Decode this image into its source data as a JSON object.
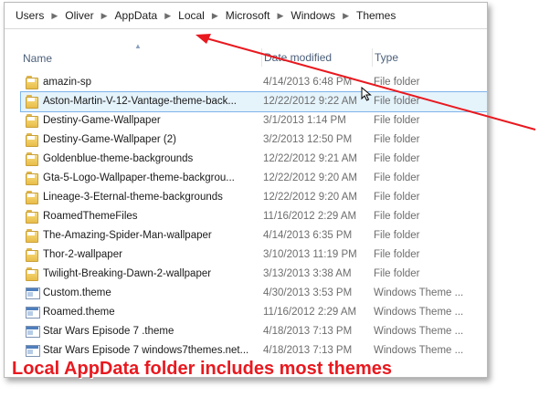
{
  "breadcrumb": [
    "Users",
    "Oliver",
    "AppData",
    "Local",
    "Microsoft",
    "Windows",
    "Themes"
  ],
  "columns": {
    "name": "Name",
    "date_modified": "Date modified",
    "type": "Type"
  },
  "files": [
    {
      "name": "amazin-sp",
      "date": "4/14/2013 6:48 PM",
      "type": "File folder",
      "icon": "folder-icon",
      "selected": false
    },
    {
      "name": "Aston-Martin-V-12-Vantage-theme-back...",
      "date": "12/22/2012 9:22 AM",
      "type": "File folder",
      "icon": "folder-icon",
      "selected": true
    },
    {
      "name": "Destiny-Game-Wallpaper",
      "date": "3/1/2013 1:14 PM",
      "type": "File folder",
      "icon": "folder-icon",
      "selected": false
    },
    {
      "name": "Destiny-Game-Wallpaper (2)",
      "date": "3/2/2013 12:50 PM",
      "type": "File folder",
      "icon": "folder-icon",
      "selected": false
    },
    {
      "name": "Goldenblue-theme-backgrounds",
      "date": "12/22/2012 9:21 AM",
      "type": "File folder",
      "icon": "folder-icon",
      "selected": false
    },
    {
      "name": "Gta-5-Logo-Wallpaper-theme-backgrou...",
      "date": "12/22/2012 9:20 AM",
      "type": "File folder",
      "icon": "folder-icon",
      "selected": false
    },
    {
      "name": "Lineage-3-Eternal-theme-backgrounds",
      "date": "12/22/2012 9:20 AM",
      "type": "File folder",
      "icon": "folder-icon",
      "selected": false
    },
    {
      "name": "RoamedThemeFiles",
      "date": "11/16/2012 2:29 AM",
      "type": "File folder",
      "icon": "folder-icon",
      "selected": false
    },
    {
      "name": "The-Amazing-Spider-Man-wallpaper",
      "date": "4/14/2013 6:35 PM",
      "type": "File folder",
      "icon": "folder-icon",
      "selected": false
    },
    {
      "name": "Thor-2-wallpaper",
      "date": "3/10/2013 11:19 PM",
      "type": "File folder",
      "icon": "folder-icon",
      "selected": false
    },
    {
      "name": "Twilight-Breaking-Dawn-2-wallpaper",
      "date": "3/13/2013 3:38 AM",
      "type": "File folder",
      "icon": "folder-icon",
      "selected": false
    },
    {
      "name": "Custom.theme",
      "date": "4/30/2013 3:53 PM",
      "type": "Windows Theme ...",
      "icon": "theme-file-icon",
      "selected": false
    },
    {
      "name": "Roamed.theme",
      "date": "11/16/2012 2:29 AM",
      "type": "Windows Theme ...",
      "icon": "theme-file-icon",
      "selected": false
    },
    {
      "name": "Star Wars Episode 7 .theme",
      "date": "4/18/2013 7:13 PM",
      "type": "Windows Theme ...",
      "icon": "theme-file-icon",
      "selected": false
    },
    {
      "name": "Star Wars Episode 7 windows7themes.net...",
      "date": "4/18/2013 7:13 PM",
      "type": "Windows Theme ...",
      "icon": "theme-file-icon",
      "selected": false
    }
  ],
  "caption": "Local AppData folder includes most themes",
  "colors": {
    "caption": "#e8191f",
    "annotation_arrow": "#e8191f",
    "selection_fill": "#e5f3fb",
    "selection_border": "#7eb4ea"
  }
}
